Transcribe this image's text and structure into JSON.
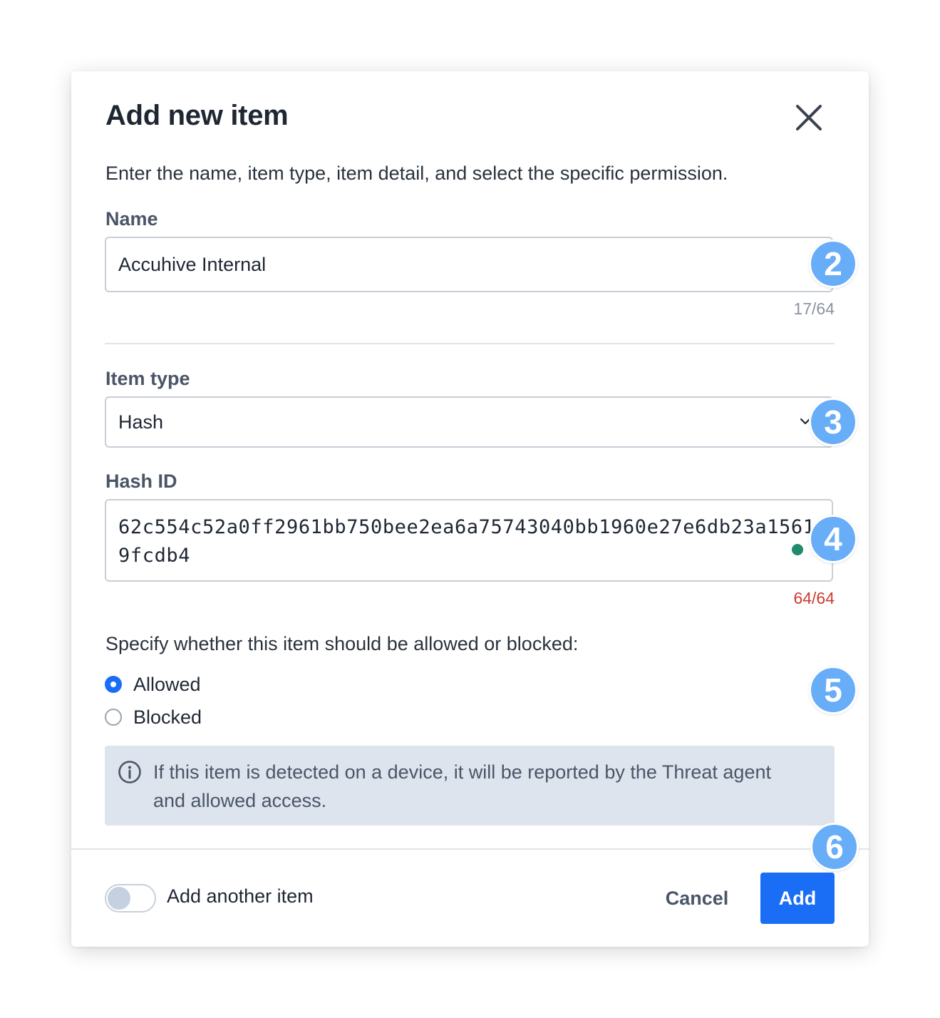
{
  "modal": {
    "title": "Add new item",
    "subtitle": "Enter the name, item type, item detail, and select the specific permission."
  },
  "name_field": {
    "label": "Name",
    "value": "Accuhive Internal",
    "counter": "17/64"
  },
  "item_type": {
    "label": "Item type",
    "selected": "Hash"
  },
  "hash_field": {
    "label": "Hash ID",
    "value": "62c554c52a0ff2961bb750bee2ea6a75743040bb1960e27e6db23a15619fcdb4",
    "counter": "64/64"
  },
  "permission": {
    "prompt": "Specify whether this item should be allowed or blocked:",
    "options": [
      {
        "label": "Allowed",
        "checked": true
      },
      {
        "label": "Blocked",
        "checked": false
      }
    ]
  },
  "info": {
    "text": "If this item is detected on a device, it will be reported by the Threat agent and allowed access."
  },
  "footer": {
    "toggle_label": "Add another item",
    "toggle_on": false,
    "cancel_label": "Cancel",
    "add_label": "Add"
  },
  "step_badges": [
    "2",
    "3",
    "4",
    "5",
    "6"
  ],
  "colors": {
    "primary": "#1a6ef5",
    "badge": "#68adf8",
    "counter_full": "#cc3b2e",
    "info_bg": "#dde4ee"
  }
}
